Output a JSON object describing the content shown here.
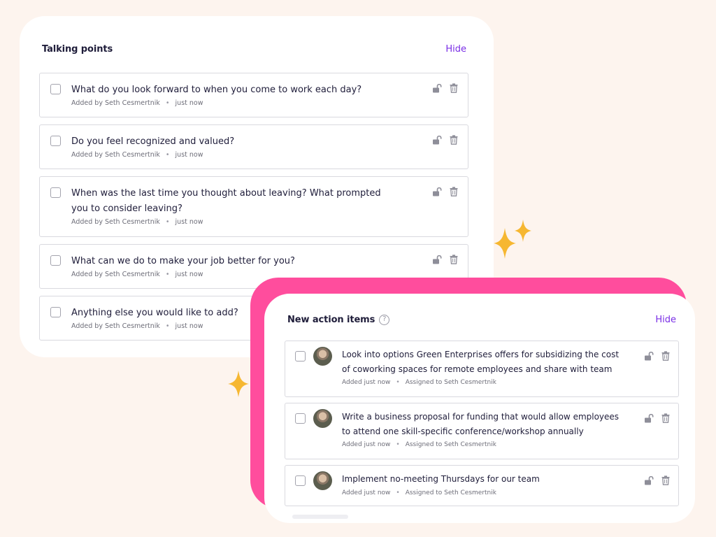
{
  "talking_points": {
    "title": "Talking points",
    "hide_label": "Hide",
    "items": [
      {
        "text": "What do you look forward to when you come to work each day?",
        "added_by": "Added by Seth Cesmertnik",
        "time": "just now"
      },
      {
        "text": "Do you feel recognized and valued?",
        "added_by": "Added by Seth Cesmertnik",
        "time": "just now"
      },
      {
        "text": "When was the last time you thought about leaving? What prompted you to consider leaving?",
        "added_by": "Added by Seth Cesmertnik",
        "time": "just now"
      },
      {
        "text": "What can we do to make your job better for you?",
        "added_by": "Added by Seth Cesmertnik",
        "time": "just now"
      },
      {
        "text": "Anything else you would like to add?",
        "added_by": "Added by Seth Cesmertnik",
        "time": "just now"
      }
    ]
  },
  "action_items": {
    "title": "New action items",
    "help_icon": "?",
    "hide_label": "Hide",
    "items": [
      {
        "text": "Look into options Green Enterprises offers for subsidizing the cost of coworking spaces for remote employees and share with team",
        "added": "Added just now",
        "assigned": "Assigned to Seth Cesmertnik"
      },
      {
        "text": "Write a business proposal for funding that would allow employees to attend one skill-specific conference/workshop annually",
        "added": "Added just now",
        "assigned": "Assigned to Seth Cesmertnik"
      },
      {
        "text": "Implement no-meeting Thursdays for our team",
        "added": "Added just now",
        "assigned": "Assigned to Seth Cesmertnik"
      }
    ]
  },
  "icons": {
    "item_actions": [
      "unlock-icon",
      "trash-icon"
    ],
    "decor": "sparkle-icon"
  },
  "colors": {
    "background": "#fdf4ee",
    "accent_purple": "#7a2ee6",
    "accent_pink": "#ff4d9d",
    "sparkle": "#f6b731"
  }
}
